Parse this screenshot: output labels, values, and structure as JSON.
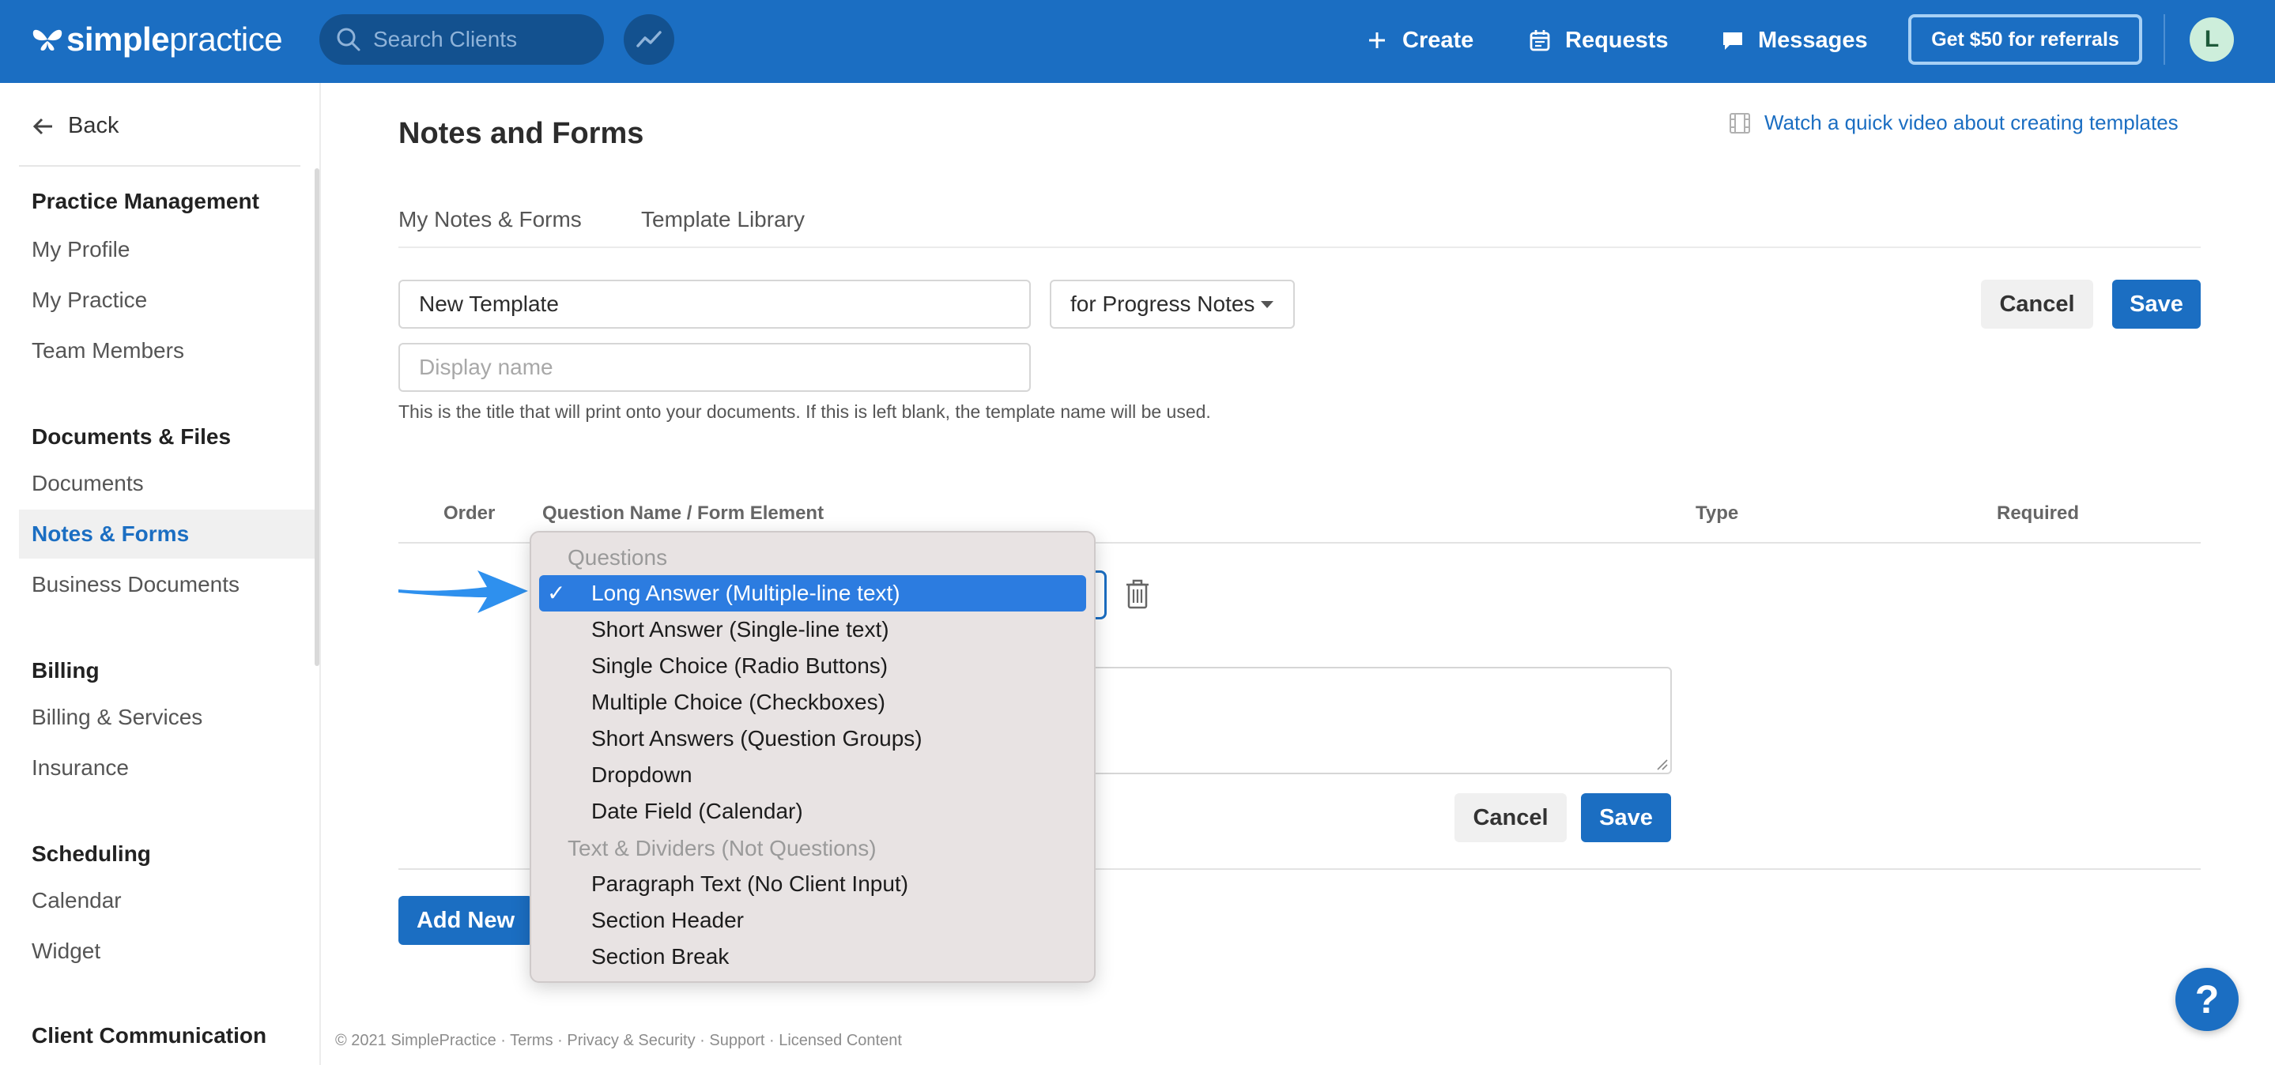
{
  "brand": {
    "name_bold": "simple",
    "name_regular": "practice"
  },
  "search": {
    "placeholder": "Search Clients"
  },
  "nav": {
    "create": "Create",
    "requests": "Requests",
    "messages": "Messages",
    "referral": "Get $50 for referrals",
    "avatar_initial": "L"
  },
  "sidebar": {
    "back": "Back",
    "sections": [
      {
        "heading": "Practice Management",
        "items": [
          "My Profile",
          "My Practice",
          "Team Members"
        ]
      },
      {
        "heading": "Documents & Files",
        "items": [
          "Documents",
          "Notes & Forms",
          "Business Documents"
        ]
      },
      {
        "heading": "Billing",
        "items": [
          "Billing & Services",
          "Insurance"
        ]
      },
      {
        "heading": "Scheduling",
        "items": [
          "Calendar",
          "Widget"
        ]
      },
      {
        "heading": "Client Communication",
        "items": []
      }
    ],
    "active_item": "Notes & Forms"
  },
  "page": {
    "title": "Notes and Forms",
    "video_link": "Watch a quick video about creating templates",
    "tabs": [
      "My Notes & Forms",
      "Template Library"
    ]
  },
  "form": {
    "template_name": "New Template",
    "template_type": "for Progress Notes",
    "display_name_placeholder": "Display name",
    "help_text": "This is the title that will print onto your documents. If this is left blank, the template name will be used.",
    "cancel": "Cancel",
    "save": "Save"
  },
  "table": {
    "headers": {
      "order": "Order",
      "question": "Question Name / Form Element",
      "type": "Type",
      "required": "Required"
    },
    "row_cancel": "Cancel",
    "row_save": "Save",
    "add_new": "Add New"
  },
  "dropdown": {
    "groups": [
      {
        "label": "Questions",
        "options": [
          "Long Answer (Multiple-line text)",
          "Short Answer (Single-line text)",
          "Single Choice (Radio Buttons)",
          "Multiple Choice (Checkboxes)",
          "Short Answers (Question Groups)",
          "Dropdown",
          "Date Field (Calendar)"
        ]
      },
      {
        "label": "Text & Dividers (Not Questions)",
        "options": [
          "Paragraph Text (No Client Input)",
          "Section Header",
          "Section Break"
        ]
      }
    ],
    "selected": "Long Answer (Multiple-line text)",
    "check_glyph": "✓"
  },
  "help_button": "?",
  "footer": "© 2021 SimplePractice · Terms · Privacy & Security · Support · Licensed Content",
  "colors": {
    "brand_blue": "#1b6ec2",
    "selected_option": "#2c7ce0",
    "dropdown_bg": "#e8e3e3"
  }
}
